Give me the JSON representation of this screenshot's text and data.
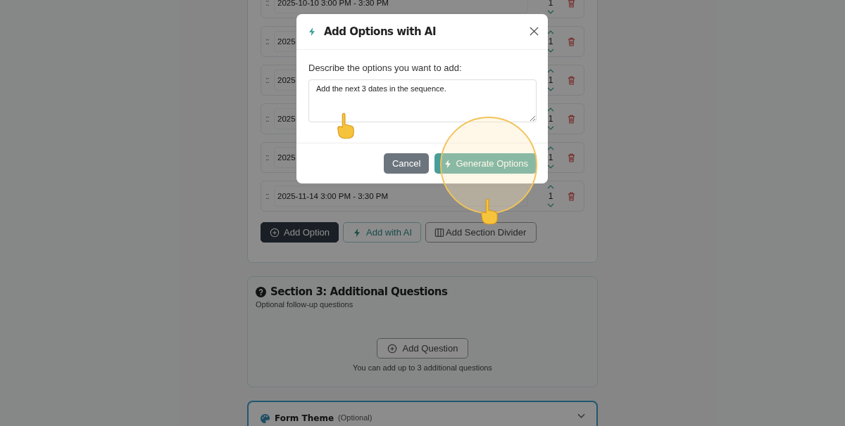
{
  "options": [
    {
      "handle": "::",
      "text": "2025-10-10 3:00 PM - 3:30 PM",
      "quantity": "1"
    },
    {
      "handle": "::",
      "text": "2025",
      "quantity": "1"
    },
    {
      "handle": "::",
      "text": "2025",
      "quantity": "1"
    },
    {
      "handle": "::",
      "text": "2025",
      "quantity": "1"
    },
    {
      "handle": "::",
      "text": "2025",
      "quantity": "1"
    },
    {
      "handle": "::",
      "text": "2025-11-14 3:00 PM - 3:30 PM",
      "quantity": "1"
    }
  ],
  "option_actions": [
    {
      "label": "Add Option",
      "kind": "primary"
    },
    {
      "label": "Add with AI",
      "kind": "ai"
    },
    {
      "label": "Add Section Divider",
      "kind": "divider"
    }
  ],
  "section_3": {
    "title": "Section 3: Additional Questions",
    "subtitle": "Optional follow-up questions",
    "add_button": "Add Question",
    "note": "You can add up to 3 additional questions"
  },
  "form_theme": {
    "title": "Form Theme",
    "hint": "(Optional)",
    "expanded": false
  },
  "modal": {
    "title": "Add Options with AI",
    "prompt_label": "Describe the options you want to add:",
    "prompt_value": "Add the next 3 dates in the sequence.",
    "buttons": [
      {
        "label": "Cancel",
        "kind": "secondary"
      },
      {
        "label": "Generate Options",
        "kind": "primary"
      }
    ]
  }
}
